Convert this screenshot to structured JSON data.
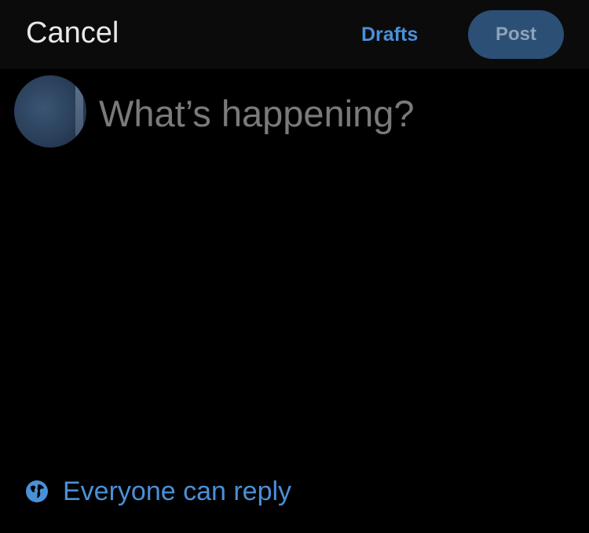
{
  "header": {
    "cancel_label": "Cancel",
    "drafts_label": "Drafts",
    "post_label": "Post"
  },
  "composer": {
    "placeholder": "What’s happening?",
    "value": ""
  },
  "reply_setting": {
    "icon": "globe-icon",
    "label": "Everyone can reply"
  },
  "colors": {
    "background": "#000000",
    "accent": "#4a90d9",
    "post_button_bg": "#2c4f75",
    "placeholder": "#7a7a7a"
  }
}
